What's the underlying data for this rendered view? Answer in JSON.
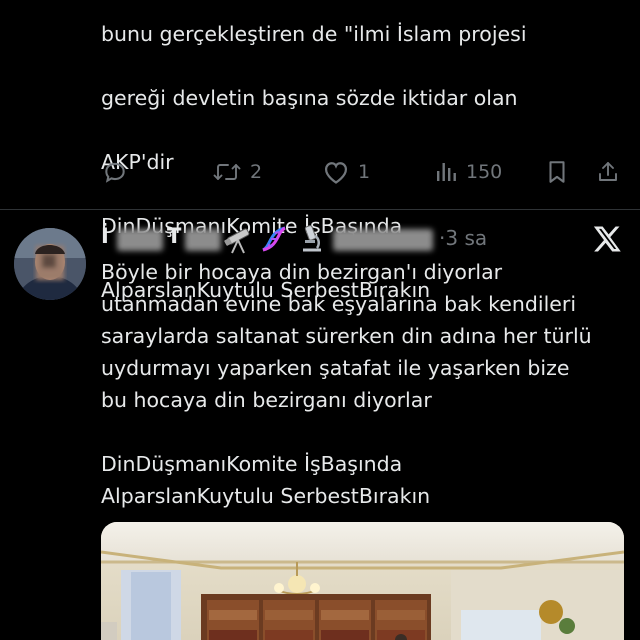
{
  "previous_tweet": {
    "text_lines": [
      "bunu gerçekleştiren de \"ilmi İslam projesi",
      "gereği devletin başına sözde iktidar olan",
      "AKP'dir",
      "DinDüşmanıKomite İşBaşında",
      "AlparslanKuytulu SerbestBırakın"
    ],
    "actions": {
      "reply_icon": "reply-icon",
      "retweet_count": "2",
      "like_count": "1",
      "views_count": "150",
      "bookmark_icon": "bookmark-icon",
      "share_icon": "share-icon"
    }
  },
  "tweet": {
    "author_initial_1": "İ",
    "author_initial_2": "T",
    "author_emojis": [
      "telescope-icon",
      "dna-icon",
      "microscope-icon"
    ],
    "time": "·3 sa",
    "platform_logo": "x-logo-icon",
    "paragraphs": [
      "Böyle bir hocaya din bezirgan'ı diyorlar\nutanmadan evine bak eşyalarına bak kendileri\nsaraylarda saltanat sürerken din adına her türlü\nuydurmayı yaparken şatafat ile yaşarken bize\nbu hocaya din bezirganı diyorlar",
      "DinDüşmanıKomite İşBaşında\nAlparslanKuytulu SerbestBırakın"
    ],
    "media": "room-photo"
  },
  "colors": {
    "background": "#000000",
    "text": "#e7e9ea",
    "muted": "#71767b",
    "divider": "#2f3336"
  }
}
